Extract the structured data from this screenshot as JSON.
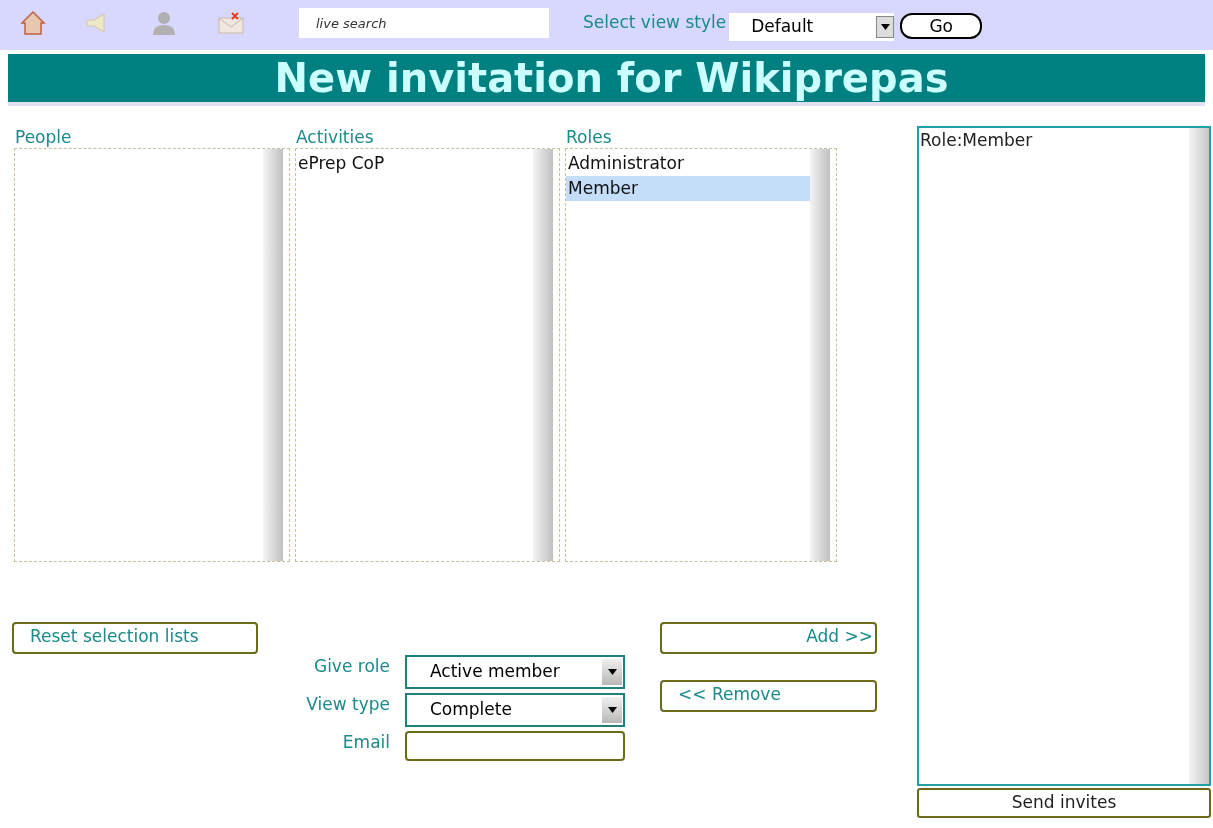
{
  "toolbar": {
    "search": {
      "placeholder": "live search"
    },
    "view_style": {
      "label": "Select view style",
      "value": "Default",
      "button": "Go"
    }
  },
  "title": "New invitation for Wikiprepas",
  "lists": [
    {
      "label": "People"
    },
    {
      "label": "Activities",
      "items": [
        {
          "text": "ePrep CoP",
          "selected": false
        }
      ]
    },
    {
      "label": "Roles",
      "items": [
        {
          "text": "Administrator",
          "selected": false
        },
        {
          "text": "Member",
          "selected": true
        }
      ]
    }
  ],
  "reset_button": "Reset selection lists",
  "form": [
    {
      "kind": "select",
      "label": "Give role",
      "value": "Active member"
    },
    {
      "kind": "select",
      "label": "View type",
      "value": "Complete"
    },
    {
      "kind": "text",
      "label": "Email"
    }
  ],
  "add_button": "Add >>",
  "remove_button": "<< Remove",
  "invites": {
    "items": [
      "Role:Member"
    ],
    "button": "Send invites"
  }
}
